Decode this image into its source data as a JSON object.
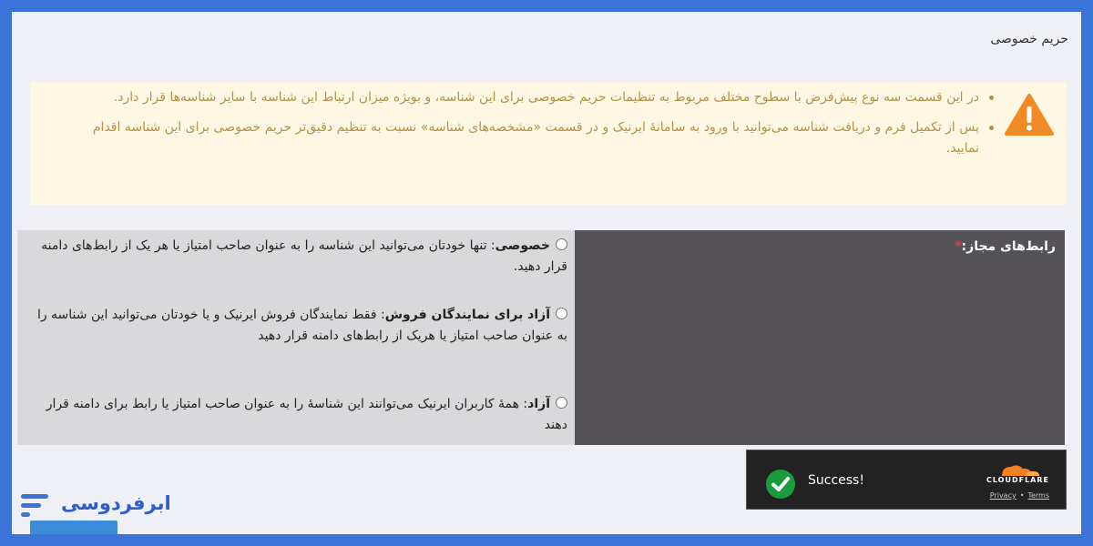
{
  "section": {
    "title": "حریم خصوصی"
  },
  "notice": {
    "icon": "warning-icon",
    "color": "#b5924a",
    "items": [
      "در این قسمت سه نوع پیش‌فرض با سطوح مختلف مربوط به تنظیمات حریم خصوصی برای این شناسه، و بویژه میزان ارتباط این شناسه با سایر شناسه‌ها قرار دارد.",
      "پس از تکمیل فرم و دریافت شناسه می‌توانید با ورود به سامانهٔ ایرنیک و در قسمت «مشخصه‌های شناسه» نسبت به تنظیم دقیق‌تر حریم خصوصی برای این شناسه اقدام نمایید."
    ]
  },
  "permissions": {
    "label": "رابط‌های مجاز:",
    "required_mark": "*",
    "options": [
      {
        "title": "خصوصی",
        "desc": ": تنها خودتان می‌توانید این شناسه را به عنوان صاحب امتیاز یا هر یک از رابط‌های دامنه قرار دهید.",
        "selected": false
      },
      {
        "title": "آزاد برای نمایندگان فروش",
        "desc": ": فقط نمایندگان فروش ایرنیک و یا خودتان می‌توانید این شناسه را به عنوان صاحب امتیاز یا هریک از رابط‌های دامنه قرار دهید",
        "selected": false
      },
      {
        "title": "آزاد",
        "desc": ": همهٔ کاربران ایرنیک می‌توانند این شناسهٔ را به عنوان صاحب امتیاز یا رابط برای دامنه قرار دهند",
        "selected": false
      }
    ]
  },
  "captcha": {
    "status": "Success!",
    "brand": "CLOUDFLARE",
    "privacy": "Privacy",
    "separator": "•",
    "terms": "Terms",
    "colors": {
      "check": "#1a9c3e",
      "cloud": "#f48120"
    }
  },
  "watermark": {
    "name": "ابرفردوسی",
    "color": "#2c5fc7"
  }
}
